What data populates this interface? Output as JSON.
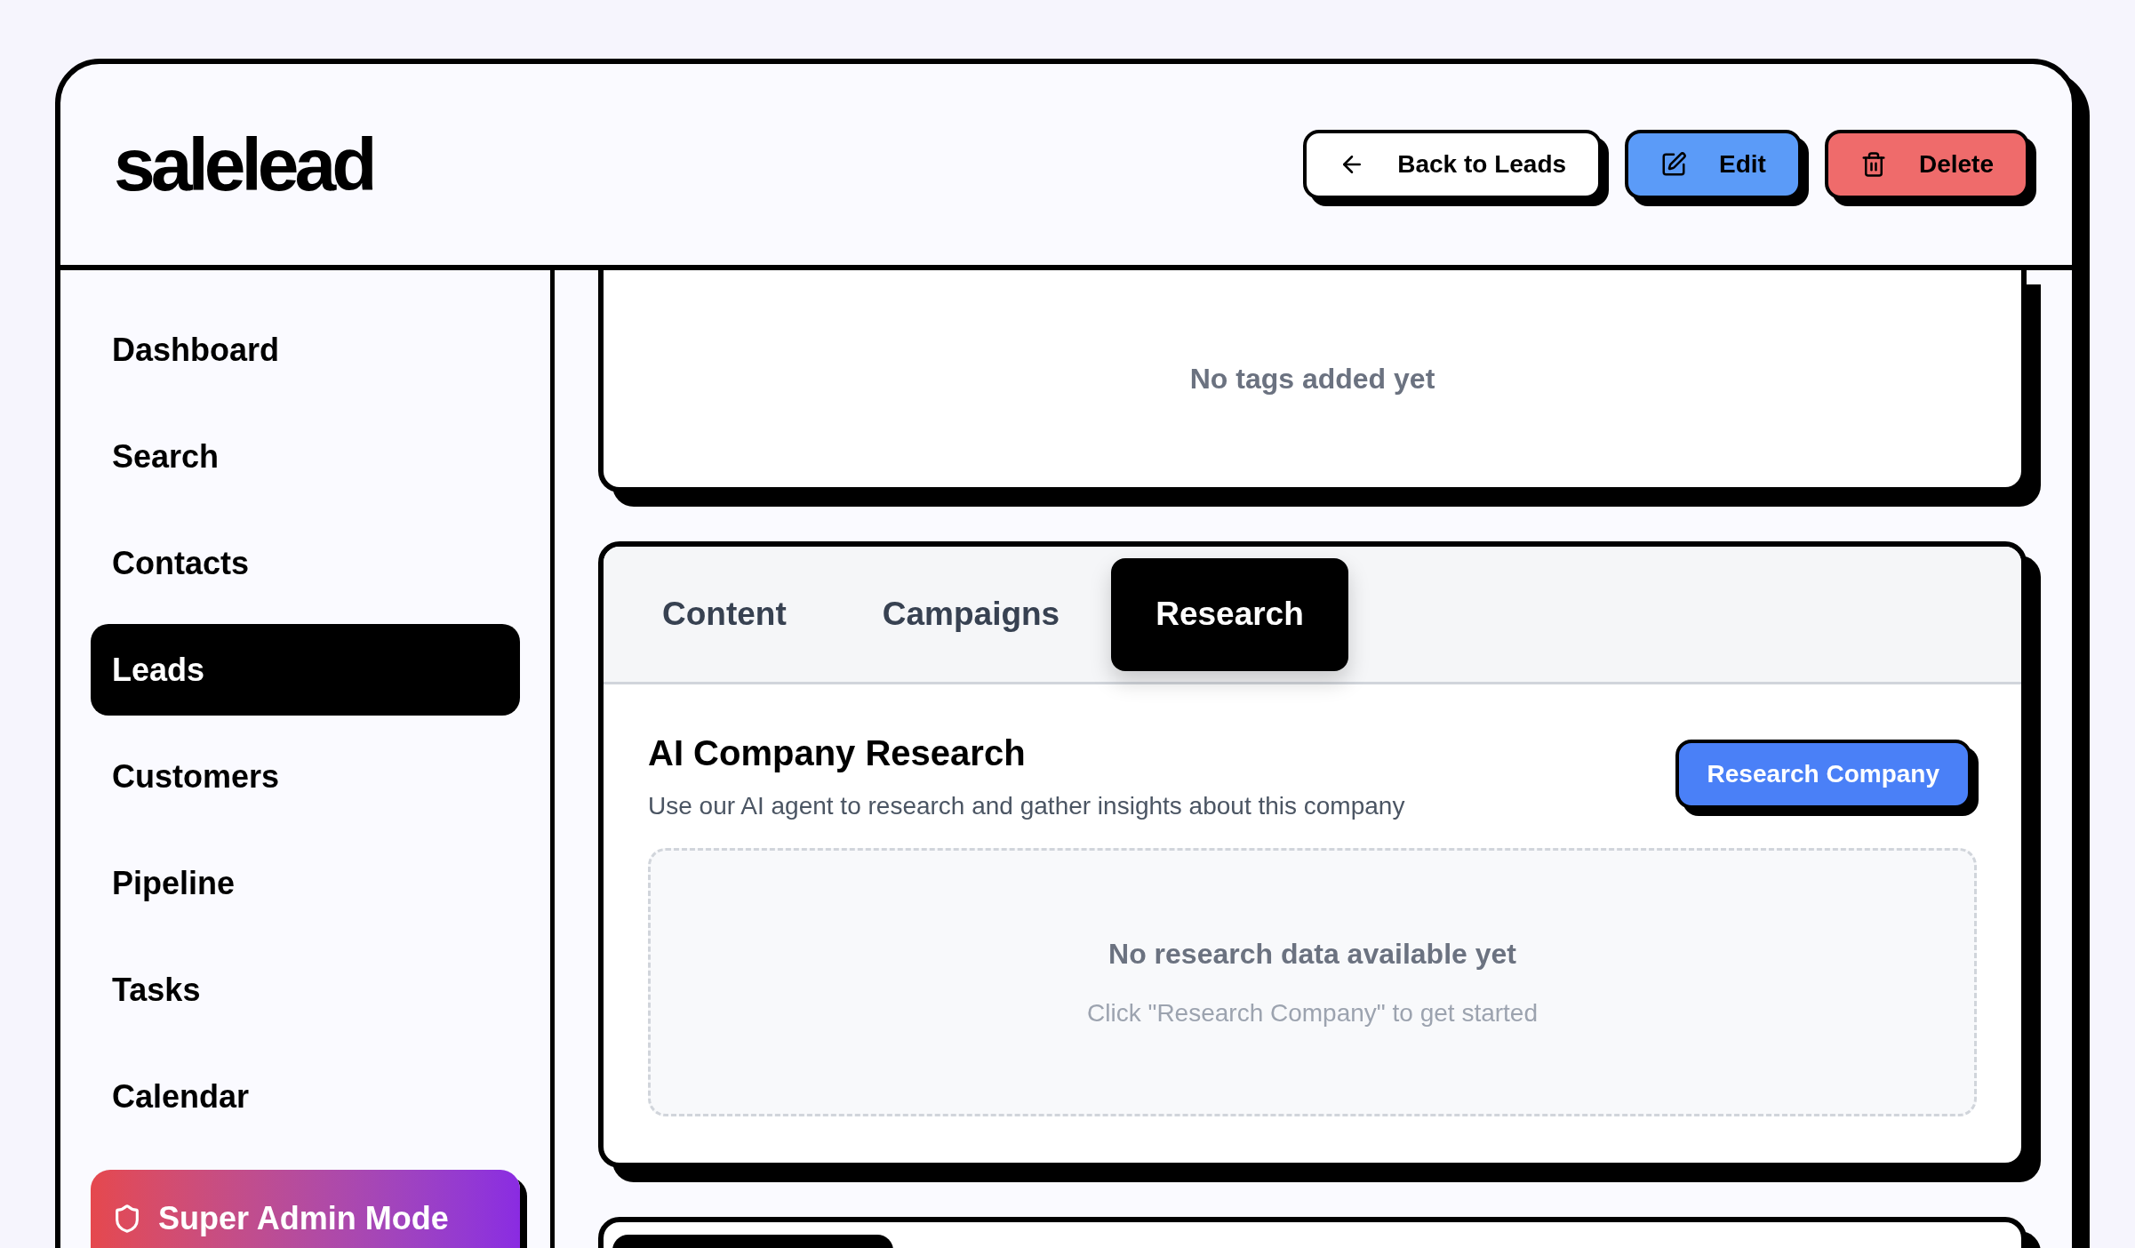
{
  "logo": "salelead",
  "header_buttons": [
    {
      "kind": "back",
      "label": "Back to Leads"
    },
    {
      "kind": "edit",
      "label": "Edit"
    },
    {
      "kind": "delete",
      "label": "Delete"
    }
  ],
  "sidebar": {
    "items": [
      {
        "label": "Dashboard",
        "selected": false
      },
      {
        "label": "Search",
        "selected": false
      },
      {
        "label": "Contacts",
        "selected": false
      },
      {
        "label": "Leads",
        "selected": true
      },
      {
        "label": "Customers",
        "selected": false
      },
      {
        "label": "Pipeline",
        "selected": false
      },
      {
        "label": "Tasks",
        "selected": false
      },
      {
        "label": "Calendar",
        "selected": false
      }
    ],
    "admin_button": {
      "label": "Super Admin Mode"
    }
  },
  "tags_card": {
    "empty_text": "No tags added yet"
  },
  "tabs": [
    {
      "label": "Content",
      "selected": false
    },
    {
      "label": "Campaigns",
      "selected": false
    },
    {
      "label": "Research",
      "selected": true
    }
  ],
  "research": {
    "title": "AI Company Research",
    "subtitle": "Use our AI agent to research and gather insights about this company",
    "button": "Research Company",
    "empty_title": "No research data available yet",
    "empty_hint": "Click \"Research Company\" to get started"
  }
}
